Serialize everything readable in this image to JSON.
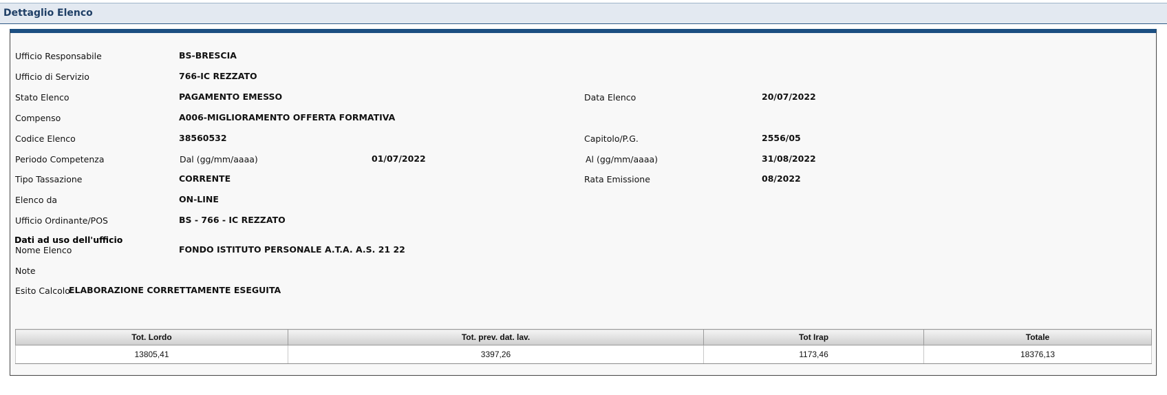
{
  "header": {
    "title": "Dettaglio Elenco"
  },
  "fields": {
    "ufficio_responsabile": {
      "label": "Ufficio Responsabile",
      "value": "BS-BRESCIA"
    },
    "ufficio_servizio": {
      "label": "Ufficio di Servizio",
      "value": "766-IC REZZATO"
    },
    "stato_elenco": {
      "label": "Stato Elenco",
      "value": "PAGAMENTO EMESSO"
    },
    "data_elenco": {
      "label": "Data Elenco",
      "value": "20/07/2022"
    },
    "compenso": {
      "label": "Compenso",
      "value": "A006-MIGLIORAMENTO OFFERTA FORMATIVA"
    },
    "codice_elenco": {
      "label": "Codice Elenco",
      "value": "38560532"
    },
    "capitolo": {
      "label": "Capitolo/P.G.",
      "value": "2556/05"
    },
    "periodo": {
      "label": "Periodo Competenza",
      "dal_label": "Dal (gg/mm/aaaa)",
      "dal_value": "01/07/2022",
      "al_label": "Al (gg/mm/aaaa)",
      "al_value": "31/08/2022"
    },
    "tipo_tassazione": {
      "label": "Tipo Tassazione",
      "value": "CORRENTE"
    },
    "rata_emissione": {
      "label": "Rata Emissione",
      "value": "08/2022"
    },
    "elenco_da": {
      "label": "Elenco da",
      "value": "ON-LINE"
    },
    "ufficio_ordinante": {
      "label": "Ufficio Ordinante/POS",
      "value": "BS - 766 - IC REZZATO"
    },
    "dati_ufficio": {
      "heading": "Dati ad uso dell'ufficio"
    },
    "nome_elenco": {
      "label": "Nome Elenco",
      "value": "FONDO ISTITUTO PERSONALE A.T.A. A.S. 21 22"
    },
    "note": {
      "label": "Note",
      "value": ""
    },
    "esito_calcolo": {
      "label": "Esito Calcolo",
      "value": "ELABORAZIONE CORRETTAMENTE ESEGUITA"
    }
  },
  "totals": {
    "headers": [
      "Tot. Lordo",
      "Tot. prev. dat. lav.",
      "Tot Irap",
      "Totale"
    ],
    "values": [
      "13805,41",
      "3397,26",
      "1173,46",
      "18376,13"
    ]
  }
}
